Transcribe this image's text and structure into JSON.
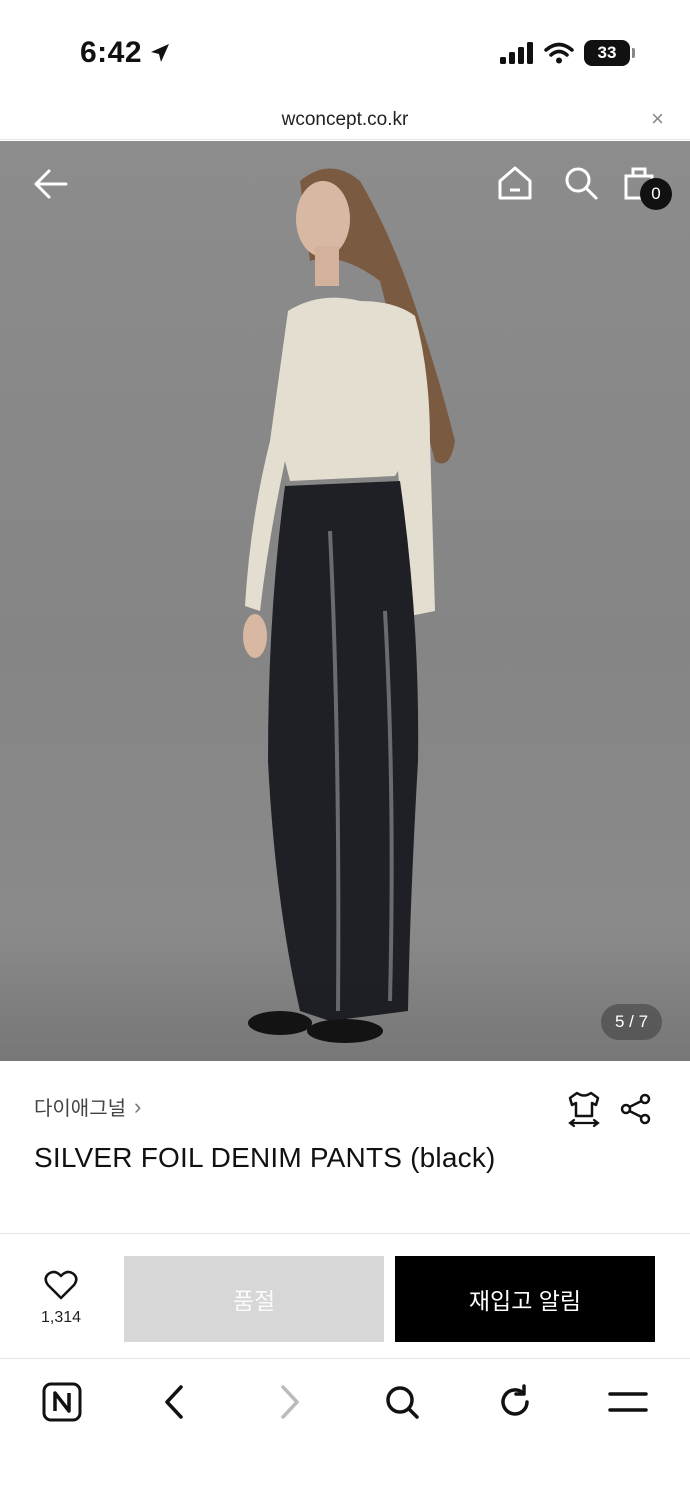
{
  "status_bar": {
    "time": "6:42",
    "battery": "33"
  },
  "browser": {
    "url": "wconcept.co.kr",
    "close_glyph": "×"
  },
  "gallery": {
    "counter": "5 / 7",
    "cart_count": "0"
  },
  "product": {
    "brand": "다이애그널",
    "brand_chevron": "›",
    "title": "SILVER FOIL DENIM PANTS (black)"
  },
  "actions": {
    "like_count": "1,314",
    "soldout_label": "품절",
    "restock_label": "재입고 알림"
  },
  "icons": {
    "status": [
      "location-arrow-icon",
      "signal-icon",
      "wifi-icon",
      "battery-icon"
    ],
    "hero": [
      "back-arrow-icon",
      "home-icon",
      "search-icon",
      "shopping-bag-icon"
    ],
    "product": [
      "size-guide-icon",
      "share-icon",
      "heart-icon"
    ],
    "toolbar": [
      "naver-home-icon",
      "chevron-left-icon",
      "chevron-right-icon",
      "search-icon",
      "refresh-icon",
      "menu-icon"
    ]
  },
  "colors": {
    "accent": "#000000",
    "soldout_bg": "#d7d7d7",
    "hero_bg": "#878787"
  }
}
